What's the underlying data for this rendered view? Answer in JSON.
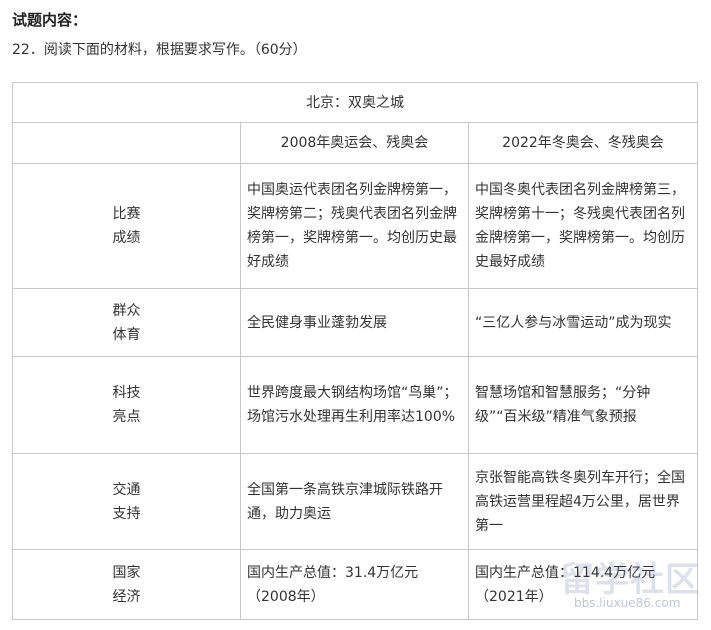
{
  "heading": "试题内容：",
  "question": "22．阅读下面的材料，根据要求写作。（60分）",
  "table": {
    "title": "北京：双奥之城",
    "col_headers": [
      "",
      "2008年奥运会、残奥会",
      "2022年冬奥会、冬残奥会"
    ],
    "rows": [
      {
        "label": [
          "比赛",
          "成绩"
        ],
        "col2008": "中国奥运代表团名列金牌榜第一，奖牌榜第二；残奥代表团名列金牌榜第一，奖牌榜第一。均创历史最好成绩",
        "col2022": "中国冬奥代表团名列金牌榜第三，奖牌榜第十一；冬残奥代表团名列金牌榜第一，奖牌榜第一。均创历史最好成绩"
      },
      {
        "label": [
          "群众",
          "体育"
        ],
        "col2008": "全民健身事业蓬勃发展",
        "col2022": "“三亿人参与冰雪运动”成为现实"
      },
      {
        "label": [
          "科技",
          "亮点"
        ],
        "col2008": "世界跨度最大钢结构场馆“鸟巢”；场馆污水处理再生利用率达100%",
        "col2022": "智慧场馆和智慧服务；“分钟级”“百米级”精准气象预报"
      },
      {
        "label": [
          "交通",
          "支持"
        ],
        "col2008": "全国第一条高铁京津城际铁路开通，助力奥运",
        "col2022": "京张智能高铁冬奥列车开行；全国高铁运营里程超4万公里，居世界第一"
      },
      {
        "label": [
          "国家",
          "经济"
        ],
        "col2008": "国内生产总值：31.4万亿元（2008年）",
        "col2022": "国内生产总值：114.4万亿元（2021年）"
      }
    ]
  },
  "watermark": {
    "main": "留学社区",
    "url": "bbs.liuxue86.com"
  }
}
